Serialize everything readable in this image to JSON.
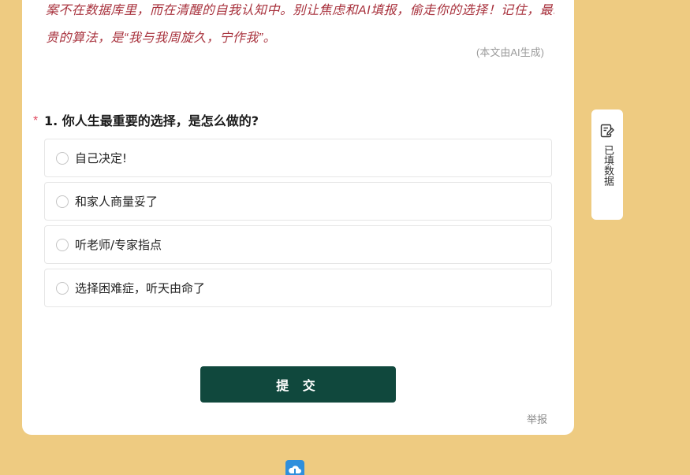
{
  "intro": {
    "line1": "案不在数据库里，而在清醒的自我认知中。别让焦虑和AI填报，偷走你的选择！记住，最珍",
    "line2": "贵的算法，是“我与我周旋久，宁作我”。"
  },
  "ai_note": "(本文由AI生成)",
  "question": {
    "required_mark": "*",
    "title": "1. 你人生最重要的选择，是怎么做的?",
    "options": [
      {
        "label": "自己决定!"
      },
      {
        "label": "和家人商量妥了"
      },
      {
        "label": "听老师/专家指点"
      },
      {
        "label": "选择困难症，听天由命了"
      }
    ]
  },
  "submit_label": "提 交",
  "report_label": "举报",
  "side_tab": {
    "label": "已填数据",
    "icon": "edit-note-icon"
  },
  "colors": {
    "background": "#eecb81",
    "intro_text": "#a8323d",
    "submit": "#10483d",
    "required": "#e0495f"
  }
}
